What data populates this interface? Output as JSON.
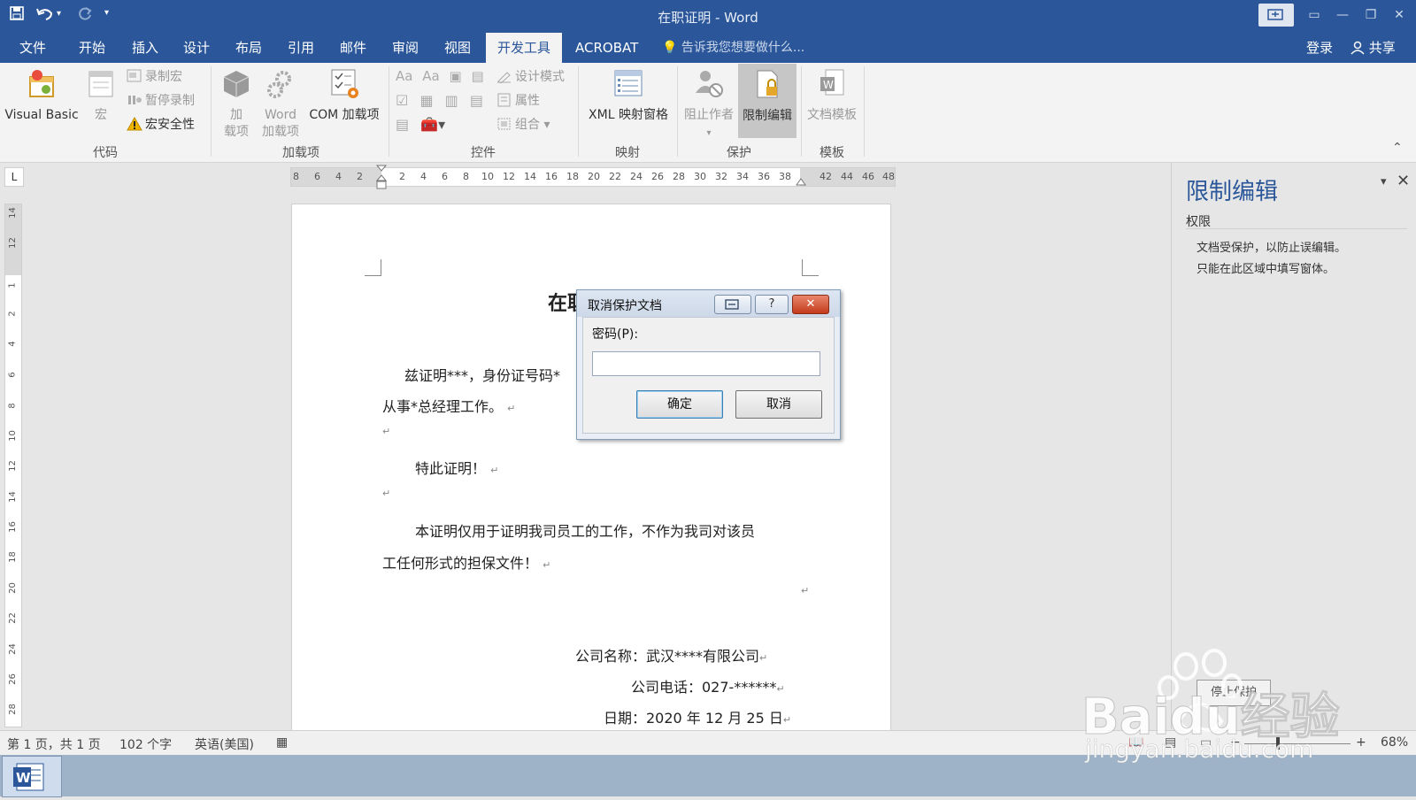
{
  "window": {
    "title": "在职证明 - Word"
  },
  "tabs": [
    "文件",
    "开始",
    "插入",
    "设计",
    "布局",
    "引用",
    "邮件",
    "审阅",
    "视图",
    "开发工具",
    "ACROBAT"
  ],
  "active_tab": "开发工具",
  "tell_me": "告诉我您想要做什么...",
  "account": {
    "login": "登录",
    "share": "共享"
  },
  "ribbon": {
    "code": {
      "label": "代码",
      "visual_basic": "Visual Basic",
      "macro": "宏",
      "record": "录制宏",
      "pause": "暂停录制",
      "security": "宏安全性"
    },
    "addins": {
      "label": "加载项",
      "addin_1": "加",
      "addin_2": "载项",
      "word_1": "Word",
      "word_2": "加载项",
      "com": "COM 加载项"
    },
    "controls": {
      "label": "控件",
      "design_mode": "设计模式",
      "properties": "属性",
      "group": "组合"
    },
    "mapping": {
      "label": "映射",
      "xml": "XML 映射窗格"
    },
    "protect": {
      "label": "保护",
      "block_authors": "阻止作者",
      "restrict_editing": "限制编辑"
    },
    "templates": {
      "label": "模板",
      "doc_template": "文档模板"
    }
  },
  "ruler": {
    "h_numbers": [
      "8",
      "6",
      "4",
      "2",
      "2",
      "4",
      "6",
      "8",
      "10",
      "12",
      "14",
      "16",
      "18",
      "20",
      "22",
      "24",
      "26",
      "28",
      "30",
      "32",
      "34",
      "36",
      "38",
      "42",
      "44",
      "46",
      "48"
    ],
    "v_numbers": [
      "14",
      "12",
      "1",
      "2",
      "4",
      "6",
      "8",
      "10",
      "12",
      "14",
      "16",
      "18",
      "20",
      "22",
      "24",
      "26",
      "28"
    ]
  },
  "document": {
    "title_visible": "在职",
    "line1": "兹证明***，身份证号码*",
    "line2": "从事*总经理工作。",
    "line3": "特此证明！",
    "line4": "本证明仅用于证明我司员工的工作，不作为我司对该员",
    "line5": "工任何形式的担保文件！",
    "company": "公司名称：武汉****有限公司",
    "phone": "公司电话：027-******",
    "date": "日期：2020 年 12 月 25 日",
    "para_mark": "↵"
  },
  "dialog": {
    "title": "取消保护文档",
    "help": "?",
    "password_label": "密码(P):",
    "password_value": "",
    "ok": "确定",
    "cancel": "取消"
  },
  "pane": {
    "title": "限制编辑",
    "section": "权限",
    "line1": "文档受保护，以防止误编辑。",
    "line2": "只能在此区域中填写窗体。",
    "stop_button": "停止保护"
  },
  "status": {
    "page": "第 1 页，共 1 页",
    "words": "102 个字",
    "language": "英语(美国)",
    "zoom": "68%"
  },
  "watermark": {
    "text": "Baidu经验",
    "url": "jingyan.baidu.com"
  },
  "colors": {
    "word_blue": "#2b579a",
    "ribbon_bg": "#f3f3f3",
    "pane_title": "#2b579a",
    "close_red": "#c43b1b"
  }
}
